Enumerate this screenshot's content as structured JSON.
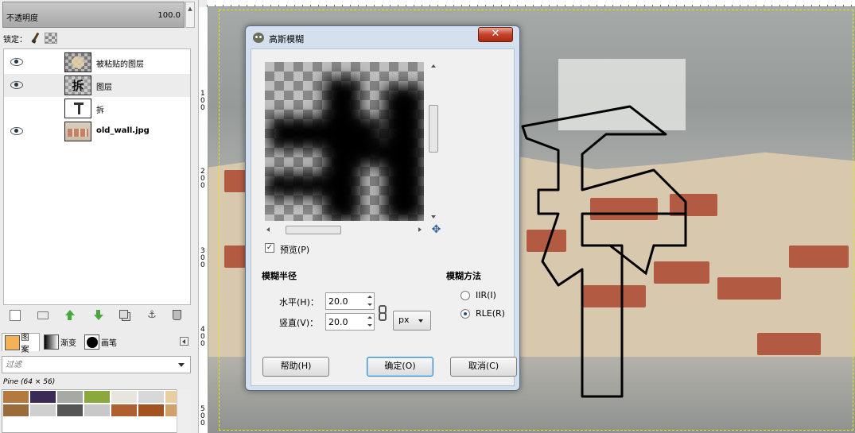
{
  "layers_panel": {
    "opacity_label": "不透明度",
    "opacity_value": "100.0",
    "lock_label": "锁定：",
    "layers": [
      {
        "name": "被粘贴的图层",
        "visible": true,
        "selected": false
      },
      {
        "name": "图层",
        "visible": true,
        "selected": true,
        "thumb_glyph": "拆"
      },
      {
        "name": "拆",
        "visible": false,
        "selected": false
      },
      {
        "name": "old_wall.jpg",
        "visible": true,
        "selected": false
      }
    ]
  },
  "brush_panel": {
    "tabs": [
      "图案",
      "渐变",
      "画笔"
    ],
    "filter_placeholder": "过滤",
    "pattern_caption": "Pine (64 × 56)",
    "pattern_colors": [
      "#b5783f",
      "#3b2a55",
      "#a7a9a4",
      "#8aa83c",
      "#e8e5df",
      "#d8d8d8",
      "#e7cfa3",
      "#9b6b3a",
      "#cfcfcf",
      "#555555",
      "#c8c8c8",
      "#b06030",
      "#a4521f",
      "#d2a06a"
    ]
  },
  "rulers": {
    "left_labels": [
      "100",
      "200",
      "300",
      "400",
      "500"
    ]
  },
  "blur_dialog": {
    "title": "高斯模糊",
    "close_glyph": "✕",
    "preview_label": "预览(P)",
    "preview_checked": true,
    "radius_section": "模糊半径",
    "horizontal_label": "水平(H)：",
    "vertical_label": "竖直(V)：",
    "horizontal_value": "20.0",
    "vertical_value": "20.0",
    "unit": "px",
    "method_section": "模糊方法",
    "methods": [
      {
        "label": "IIR(I)",
        "selected": false
      },
      {
        "label": "RLE(R)",
        "selected": true
      }
    ],
    "help_button": "帮助(H)",
    "ok_button": "确定(O)",
    "cancel_button": "取消(C)"
  },
  "colors": {
    "dialog_frame": "#d5e0ee",
    "close_button": "#c4432a",
    "ok_focus": "#3a86c8"
  }
}
